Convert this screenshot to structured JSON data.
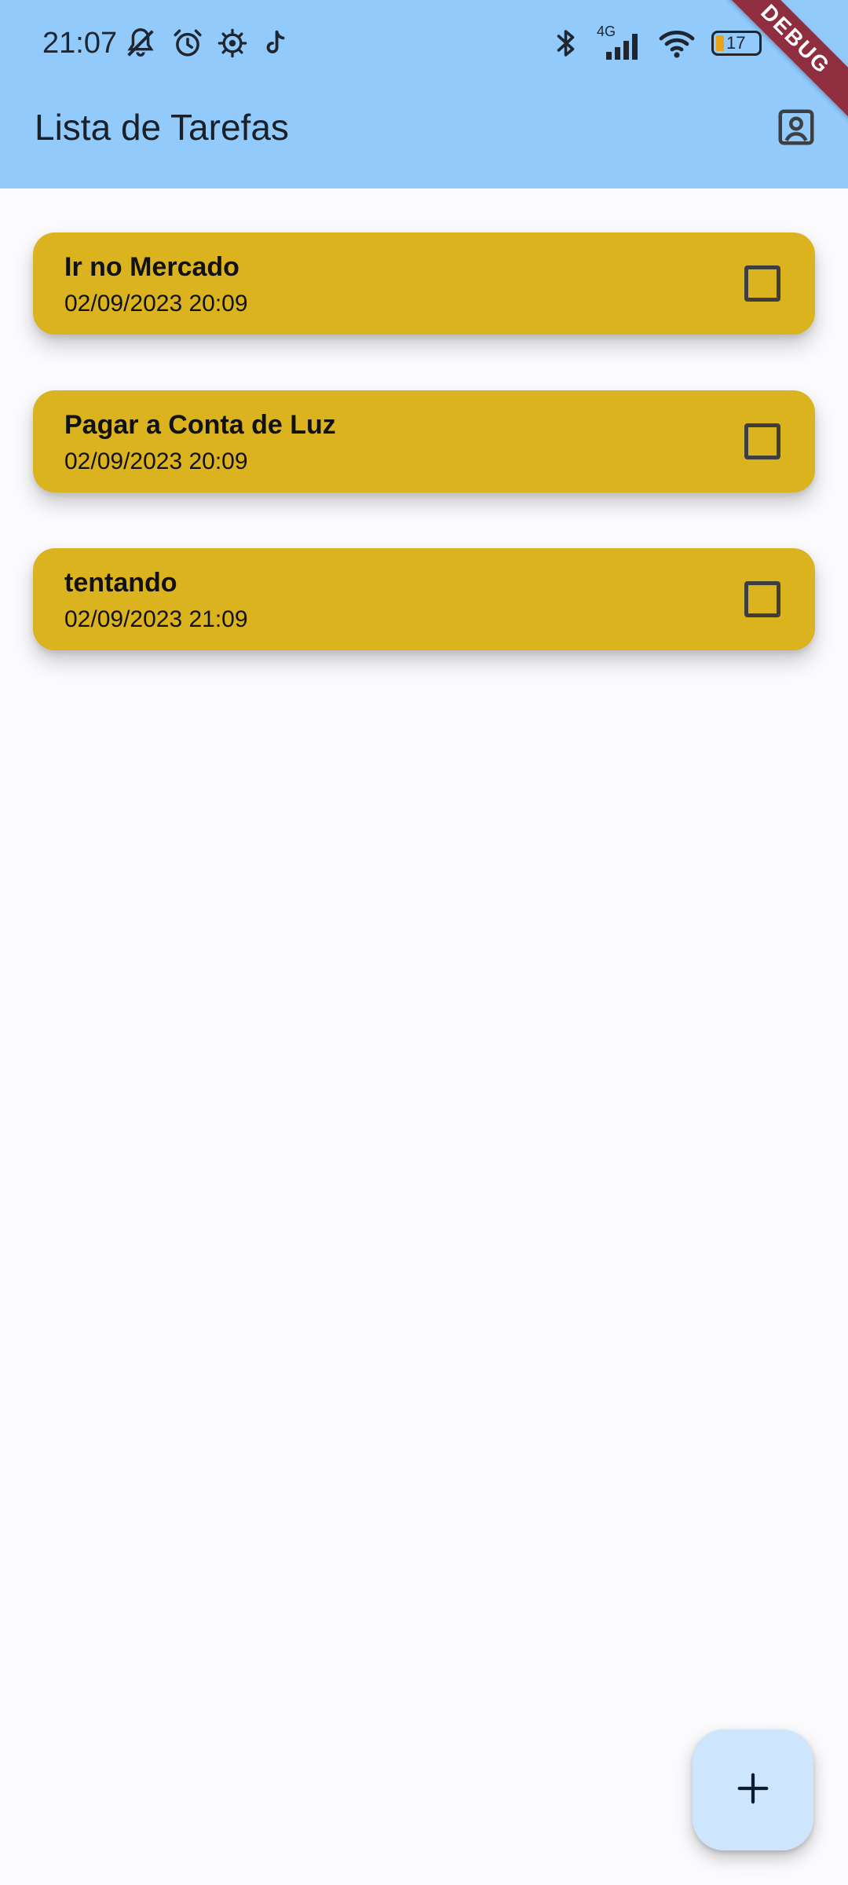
{
  "status_bar": {
    "time": "21:07",
    "network_label": "4G",
    "battery_level": "17",
    "left_icons": [
      "mute-notifications-icon",
      "alarm-icon",
      "settings-gear-icon",
      "tiktok-icon"
    ],
    "right_icons": [
      "bluetooth-icon",
      "cellular-signal-icon",
      "wifi-icon",
      "battery-icon"
    ]
  },
  "debug_banner": "DEBUG",
  "app_bar": {
    "title": "Lista de Tarefas",
    "action_icon": "account-box-icon"
  },
  "tasks": [
    {
      "title": "Ir no Mercado",
      "date": "02/09/2023 20:09",
      "completed": false
    },
    {
      "title": "Pagar a Conta de Luz",
      "date": "02/09/2023 20:09",
      "completed": false
    },
    {
      "title": "tentando",
      "date": "02/09/2023 21:09",
      "completed": false
    }
  ],
  "fab": {
    "icon": "plus-icon"
  },
  "colors": {
    "app_bar": "#92CAFC",
    "background": "#FBFBFD",
    "task_card": "#DBB31F",
    "fab": "#CDE5FD",
    "debug_banner": "#8E2E3E"
  }
}
